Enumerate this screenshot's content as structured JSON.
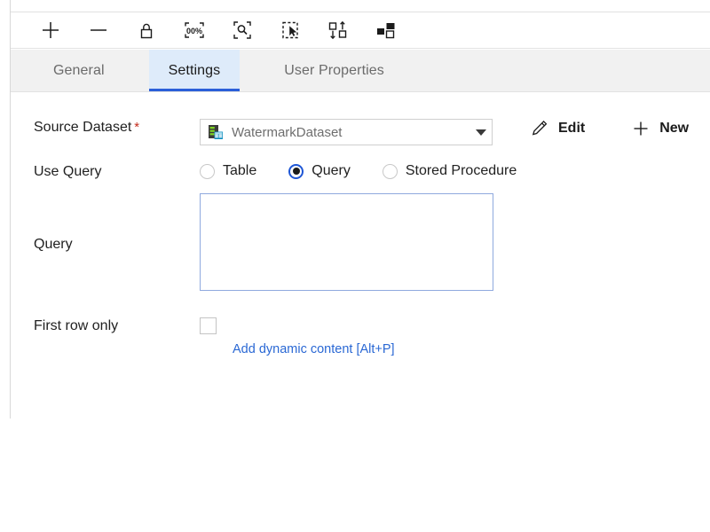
{
  "toolbar": {
    "buttons": [
      {
        "name": "zoom-in-icon",
        "label": "Zoom in"
      },
      {
        "name": "zoom-out-icon",
        "label": "Zoom out"
      },
      {
        "name": "lock-icon",
        "label": "Lock"
      },
      {
        "name": "zoom-100-icon",
        "label": "100%"
      },
      {
        "name": "zoom-to-fit-icon",
        "label": "Zoom to fit"
      },
      {
        "name": "select-all-icon",
        "label": "Select all"
      },
      {
        "name": "auto-align-icon",
        "label": "Auto align"
      },
      {
        "name": "auto-layout-icon",
        "label": "Auto layout"
      }
    ],
    "zoom_percent_label": "100%"
  },
  "tabs": [
    {
      "label": "General",
      "active": false
    },
    {
      "label": "Settings",
      "active": true
    },
    {
      "label": "User Properties",
      "active": false
    }
  ],
  "form": {
    "source_dataset": {
      "label": "Source Dataset",
      "required_marker": "*",
      "value": "WatermarkDataset",
      "dataset_icon": "dataset-icon",
      "caret_icon": "chevron-down-icon",
      "edit_button": "Edit",
      "edit_icon": "pencil-icon",
      "new_button": "New",
      "new_icon": "plus-icon"
    },
    "use_query": {
      "label": "Use Query",
      "options": [
        {
          "label": "Table",
          "selected": false
        },
        {
          "label": "Query",
          "selected": true
        },
        {
          "label": "Stored Procedure",
          "selected": false
        }
      ]
    },
    "query": {
      "label": "Query",
      "value": "",
      "placeholder": ""
    },
    "first_row_only": {
      "label": "First row only",
      "checked": false
    },
    "dynamic_content_link": "Add dynamic content [Alt+P]"
  },
  "colors": {
    "accent_blue": "#2b5fd9",
    "tab_active_bg": "#deebfa",
    "link_blue": "#2a68d4",
    "required_red": "#c42b1c",
    "textarea_border": "#8fa9de"
  }
}
